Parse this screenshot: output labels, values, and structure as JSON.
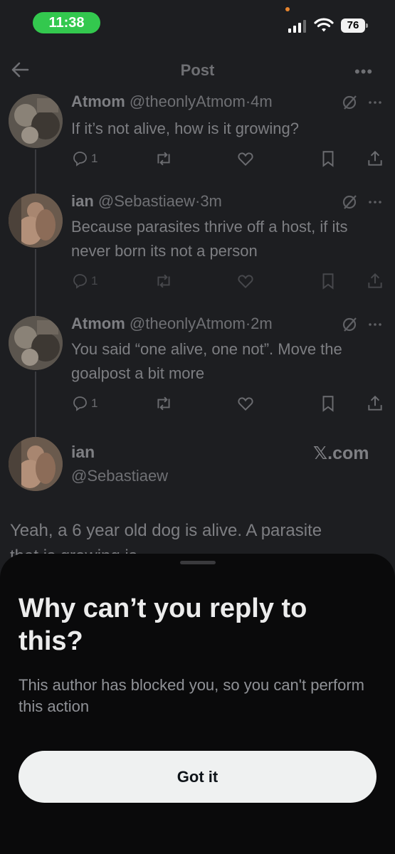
{
  "status_bar": {
    "time": "11:38",
    "battery": "76"
  },
  "nav": {
    "title": "Post"
  },
  "thread": [
    {
      "name": "Atmom",
      "handle": "@theonlyAtmom",
      "time": "·4m",
      "text": "If it’s not alive, how is it growing?",
      "replies": "1"
    },
    {
      "name": "ian",
      "handle": "@Sebastiaew",
      "time": "·3m",
      "text": "Because parasites thrive off a host, if its never born its not a person",
      "replies": "1"
    },
    {
      "name": "Atmom",
      "handle": "@theonlyAtmom",
      "time": "·2m",
      "text": "You said “one alive, one not”. Move the goalpost a bit more",
      "replies": "1"
    }
  ],
  "main_post": {
    "name": "ian",
    "handle": "@Sebastiaew",
    "source": "𝕏.com",
    "text": "Yeah, a 6 year old dog is alive. A parasite",
    "text_peek": "that is growing is"
  },
  "sheet": {
    "title": "Why can’t you reply to this?",
    "message": "This author has blocked you, so you can't perform this action",
    "button": "Got it"
  }
}
